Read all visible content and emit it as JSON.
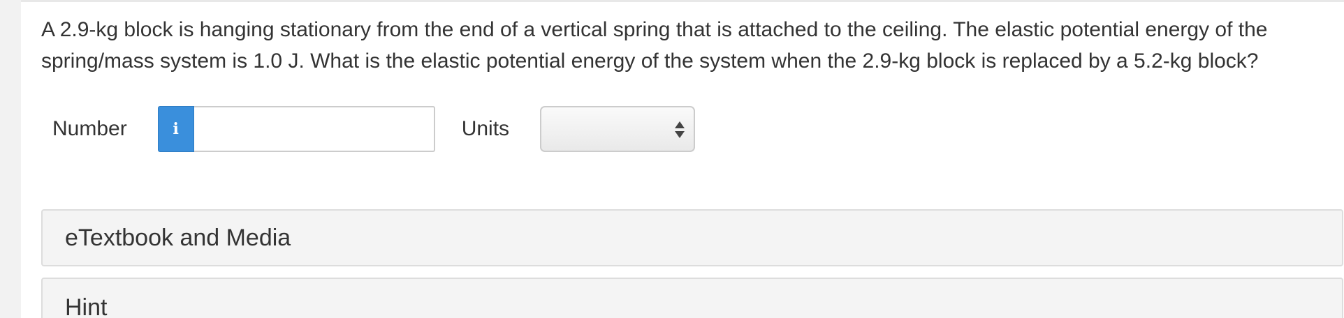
{
  "question": {
    "text": "A 2.9-kg block is hanging stationary from the end of a vertical spring that is attached to the ceiling. The elastic potential energy of the spring/mass system is 1.0 J. What is the elastic potential energy of the system when the 2.9-kg block is replaced by a 5.2-kg block?"
  },
  "answer": {
    "number_label": "Number",
    "info_glyph": "i",
    "info_icon": "info-icon",
    "number_value": "",
    "number_placeholder": "",
    "units_label": "Units",
    "units_selected": "",
    "units_icon": "sort-arrows-icon"
  },
  "panels": [
    {
      "title": "eTextbook and Media"
    },
    {
      "title": "Hint"
    }
  ],
  "colors": {
    "info_button": "#3a8fdc",
    "panel_background": "#f4f4f4",
    "text": "#333333"
  }
}
